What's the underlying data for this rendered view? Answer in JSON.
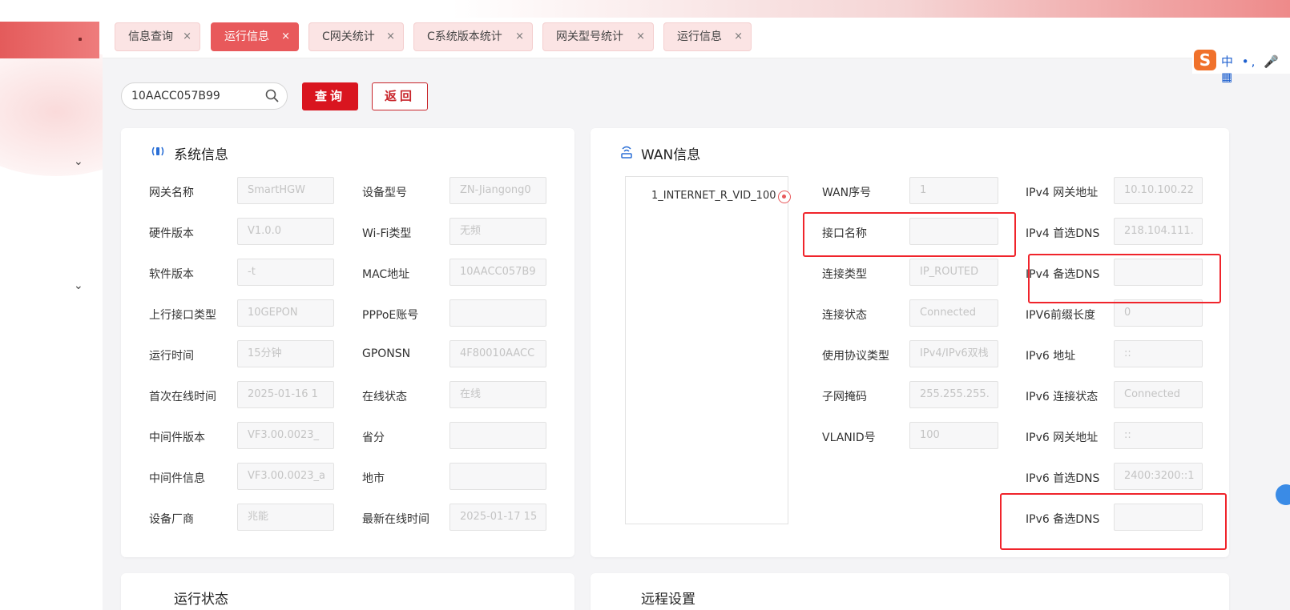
{
  "tabs": [
    {
      "label": "信息查询",
      "active": false
    },
    {
      "label": "运行信息",
      "active": true
    },
    {
      "label": "C网关统计",
      "active": false
    },
    {
      "label": "C系统版本统计",
      "active": false
    },
    {
      "label": "网关型号统计",
      "active": false
    },
    {
      "label": "运行信息",
      "active": false
    }
  ],
  "tab_close_glyph": "×",
  "ime": {
    "logo": "S",
    "text": "中 •, 🎤 ▦"
  },
  "search": {
    "value": "10AACC057B99"
  },
  "buttons": {
    "query": "查询",
    "back": "返回"
  },
  "system_info": {
    "title": "系统信息",
    "left": [
      {
        "label": "网关名称",
        "value": "SmartHGW"
      },
      {
        "label": "硬件版本",
        "value": "V1.0.0"
      },
      {
        "label": "软件版本",
        "value": "-t"
      },
      {
        "label": "上行接口类型",
        "value": "10GEPON"
      },
      {
        "label": "运行时间",
        "value": "15分钟"
      },
      {
        "label": "首次在线时间",
        "value": "2025-01-16 1"
      },
      {
        "label": "中间件版本",
        "value": "VF3.00.0023_"
      },
      {
        "label": "中间件信息",
        "value": "VF3.00.0023_a"
      },
      {
        "label": "设备厂商",
        "value": "兆能"
      }
    ],
    "right": [
      {
        "label": "设备型号",
        "value": "ZN-Jiangong0"
      },
      {
        "label": "Wi-Fi类型",
        "value": "无频"
      },
      {
        "label": "MAC地址",
        "value": "10AACC057B9"
      },
      {
        "label": "PPPoE账号",
        "value": ""
      },
      {
        "label": "GPONSN",
        "value": "4F80010AACC"
      },
      {
        "label": "在线状态",
        "value": "在线"
      },
      {
        "label": "省分",
        "value": ""
      },
      {
        "label": "地市",
        "value": ""
      },
      {
        "label": "最新在线时间",
        "value": "2025-01-17 15"
      }
    ]
  },
  "wan_info": {
    "title": "WAN信息",
    "list": [
      "1_INTERNET_R_VID_100"
    ],
    "left": [
      {
        "label": "WAN序号",
        "value": "1"
      },
      {
        "label": "接口名称",
        "value": ""
      },
      {
        "label": "连接类型",
        "value": "IP_ROUTED"
      },
      {
        "label": "连接状态",
        "value": "Connected"
      },
      {
        "label": "使用协议类型",
        "value": "IPv4/IPv6双栈"
      },
      {
        "label": "子网掩码",
        "value": "255.255.255."
      },
      {
        "label": "VLANID号",
        "value": "100"
      }
    ],
    "right": [
      {
        "label": "IPv4 网关地址",
        "value": "10.10.100.22"
      },
      {
        "label": "IPv4 首选DNS",
        "value": "218.104.111."
      },
      {
        "label": "IPv4 备选DNS",
        "value": ""
      },
      {
        "label": "IPV6前缀长度",
        "value": "0"
      },
      {
        "label": "IPv6 地址",
        "value": "::"
      },
      {
        "label": "IPv6 连接状态",
        "value": "Connected"
      },
      {
        "label": "IPv6 网关地址",
        "value": "::"
      },
      {
        "label": "IPv6 首选DNS",
        "value": "2400:3200::1"
      },
      {
        "label": "IPv6 备选DNS",
        "value": ""
      }
    ]
  },
  "bottom_cards": {
    "left_title": "运行状态",
    "right_title": "远程设置"
  },
  "colors": {
    "accent": "#d9151f",
    "tab_active": "#e8595b",
    "highlight_box": "#f0242b"
  }
}
